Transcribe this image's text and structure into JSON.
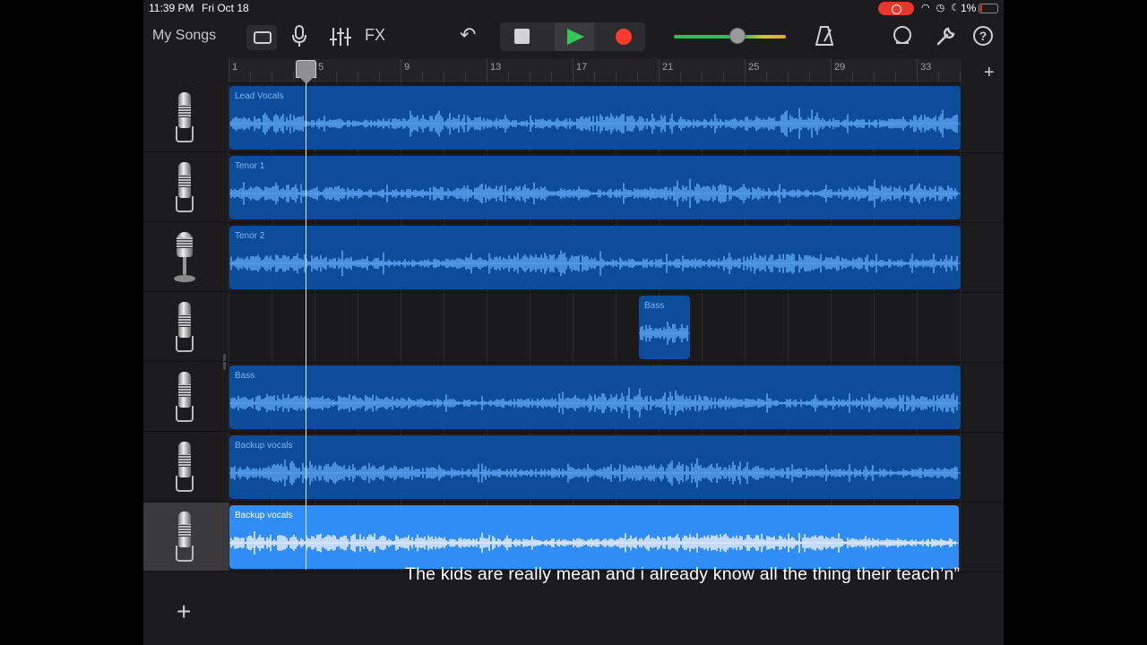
{
  "status_bar": {
    "time": "11:39 PM",
    "date": "Fri Oct 18",
    "battery": "1%"
  },
  "toolbar": {
    "my_songs": "My Songs",
    "fx": "FX",
    "help": "?"
  },
  "ruler": {
    "bar_numbers": [
      "1",
      "5",
      "9",
      "13",
      "17",
      "21",
      "25",
      "29",
      "33"
    ]
  },
  "tracks": [
    {
      "mic": "condenser-mic-icon",
      "regions": [
        {
          "name": "Lead Vocals",
          "selected": false
        }
      ]
    },
    {
      "mic": "condenser-mic-icon",
      "regions": [
        {
          "name": "Tenor 1",
          "selected": false
        }
      ]
    },
    {
      "mic": "dynamic-mic-icon",
      "regions": [
        {
          "name": "Tenor 2",
          "selected": false
        }
      ]
    },
    {
      "mic": "condenser-mic-icon",
      "regions": [
        {
          "name": "Bass",
          "selected": false
        }
      ]
    },
    {
      "mic": "condenser-mic-icon",
      "regions": [
        {
          "name": "Bass",
          "selected": false
        }
      ]
    },
    {
      "mic": "condenser-mic-icon",
      "regions": [
        {
          "name": "Backup vocals",
          "selected": false
        }
      ]
    },
    {
      "mic": "condenser-mic-icon",
      "regions": [
        {
          "name": "Backup vocals",
          "selected": true
        }
      ]
    }
  ],
  "subtitle": "The kids are really mean and i already know all the thing their teach’n”",
  "colors": {
    "region": "#0d4c9a",
    "region_selected": "#2f8df5",
    "waveform": "#5aa0f0",
    "play": "#35c759",
    "record": "#ff3b30"
  }
}
